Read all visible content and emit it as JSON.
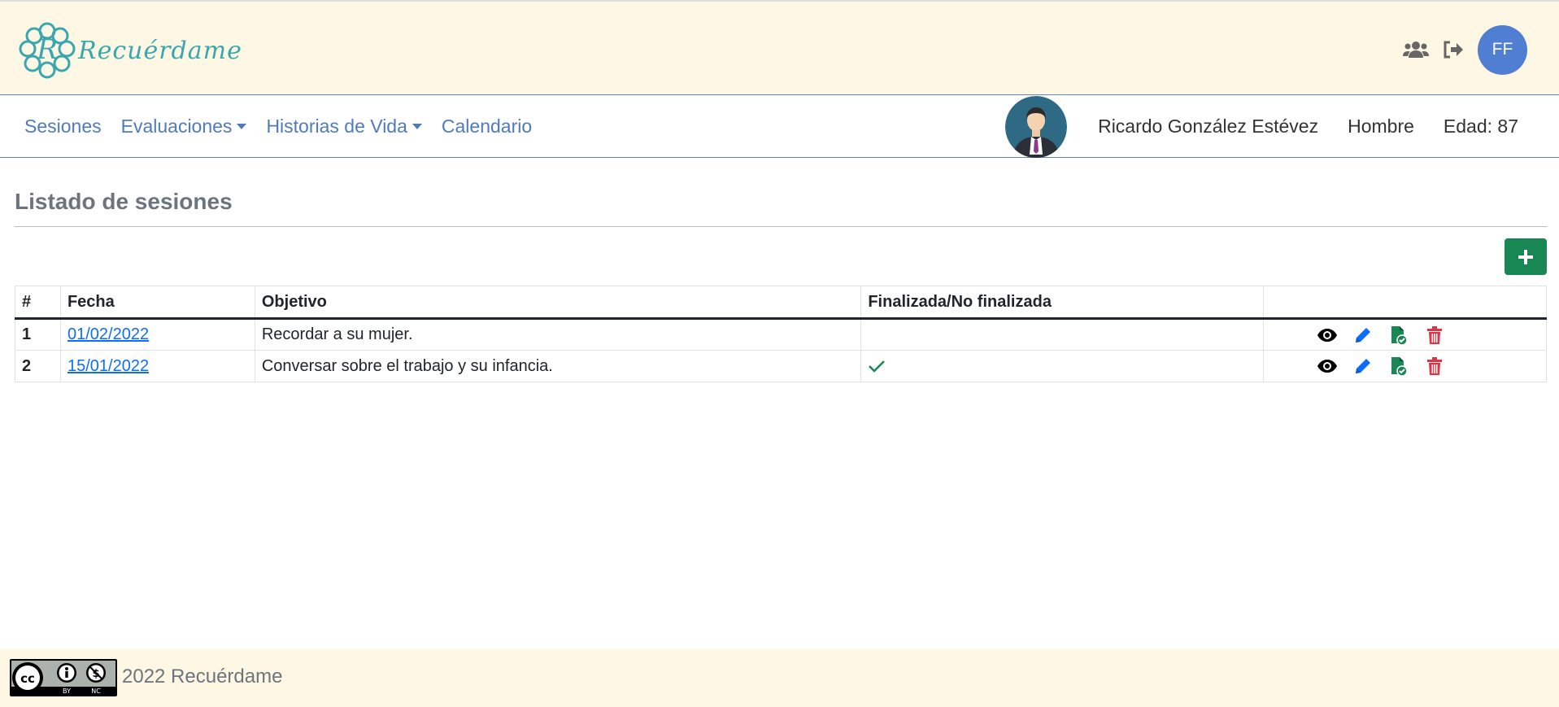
{
  "header": {
    "logo_text": "Recuérdame",
    "logo_letter": "R",
    "user_initials": "FF",
    "icons": [
      "users-icon",
      "logout-icon"
    ]
  },
  "nav": {
    "items": [
      {
        "label": "Sesiones",
        "dropdown": false
      },
      {
        "label": "Evaluaciones",
        "dropdown": true
      },
      {
        "label": "Historias de Vida",
        "dropdown": true
      },
      {
        "label": "Calendario",
        "dropdown": false
      }
    ]
  },
  "patient": {
    "name": "Ricardo González Estévez",
    "gender": "Hombre",
    "age": "Edad: 87"
  },
  "main": {
    "title": "Listado de sesiones",
    "add_button": "+",
    "table": {
      "headers": [
        "#",
        "Fecha",
        "Objetivo",
        "Finalizada/No finalizada",
        ""
      ],
      "rows": [
        {
          "num": "1",
          "fecha": "01/02/2022",
          "objetivo": "Recordar a su mujer.",
          "finalizada": false
        },
        {
          "num": "2",
          "fecha": "15/01/2022",
          "objetivo": "Conversar sobre el trabajo y su infancia.",
          "finalizada": true
        }
      ]
    }
  },
  "footer": {
    "license_badge": [
      "cc",
      "BY",
      "NC"
    ],
    "text": "2022 Recuérdame"
  },
  "colors": {
    "header_bg": "#fdf7e3",
    "accent": "#4f7ed3",
    "nav_link": "#4f7bbd",
    "success": "#198754",
    "danger": "#dc3545",
    "link": "#0d6efd"
  }
}
